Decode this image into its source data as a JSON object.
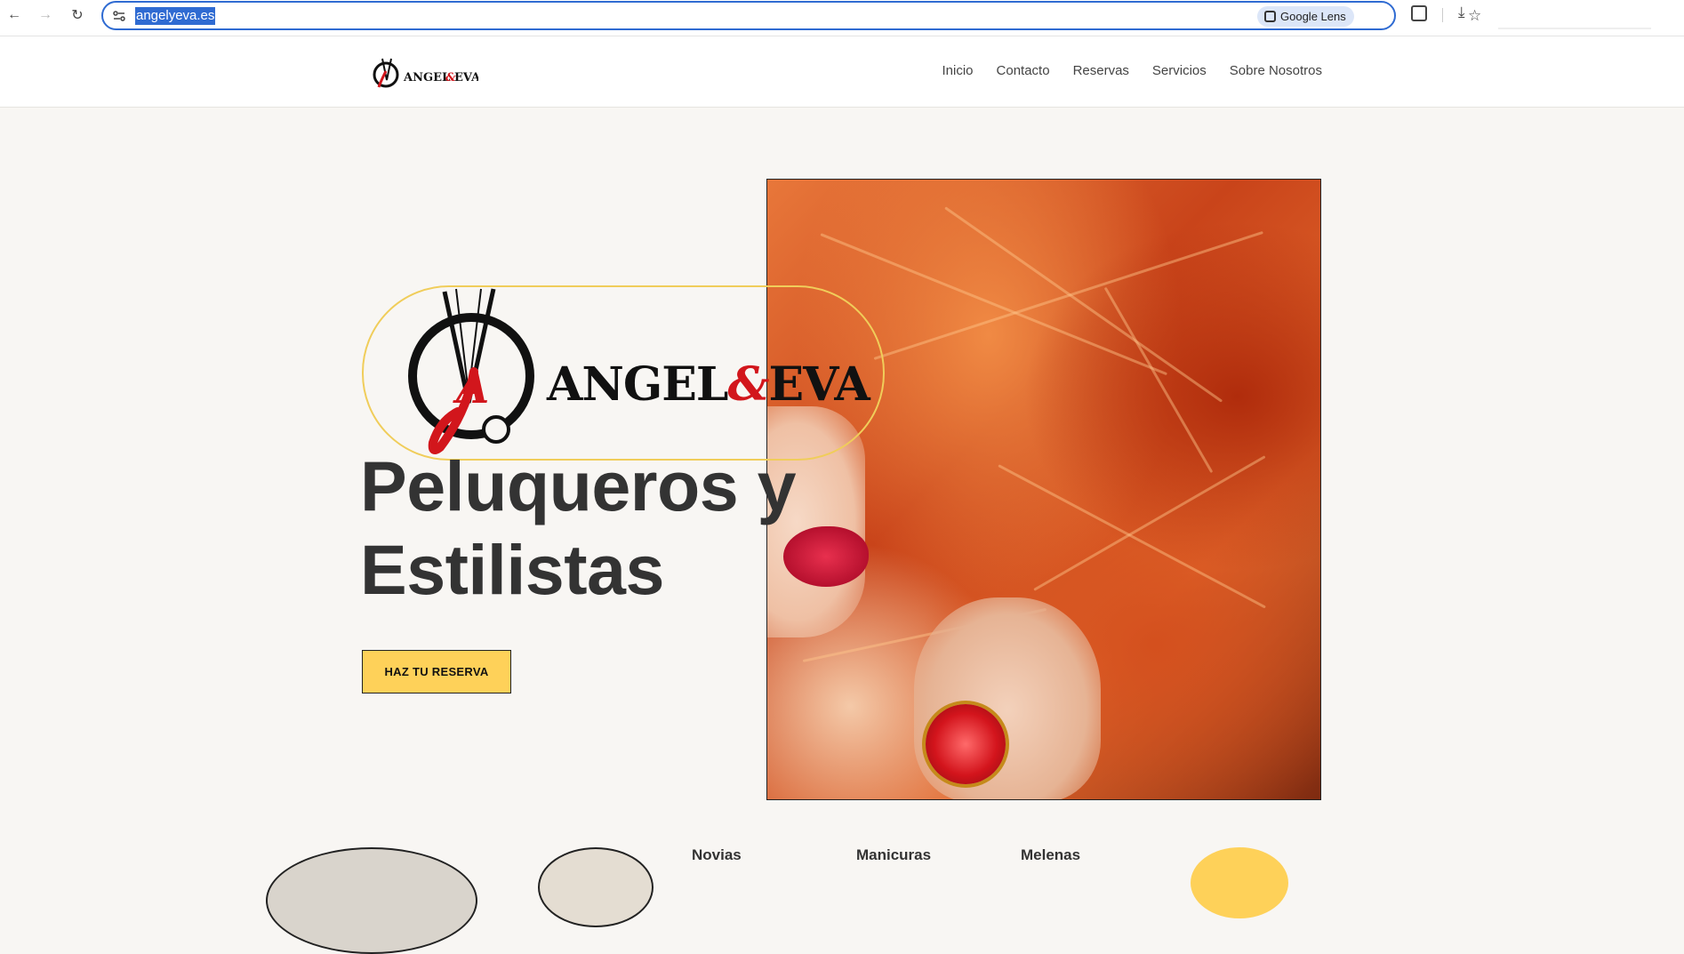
{
  "browser": {
    "url": "angelyeva.es",
    "lens_label": "Google Lens",
    "icons": [
      "back-arrow-icon",
      "forward-arrow-icon",
      "reload-icon",
      "site-info-icon",
      "bookmark-star-icon",
      "extensions-icon",
      "download-icon"
    ]
  },
  "header": {
    "logo_text": "ANGEL&EVA",
    "nav": [
      "Inicio",
      "Contacto",
      "Reservas",
      "Servicios",
      "Sobre Nosotros"
    ]
  },
  "hero": {
    "brand_left": "ANGEL",
    "brand_amp": "&",
    "brand_right": "EVA",
    "title_line1": "Peluqueros y",
    "title_line2": "Estilistas",
    "cta": "HAZ TU RESERVA",
    "colors": {
      "accent": "#fed159",
      "brand_red": "#d2161c",
      "text": "#333333",
      "background": "#f8f6f3"
    }
  },
  "services": [
    "Novias",
    "Manicuras",
    "Melenas"
  ]
}
